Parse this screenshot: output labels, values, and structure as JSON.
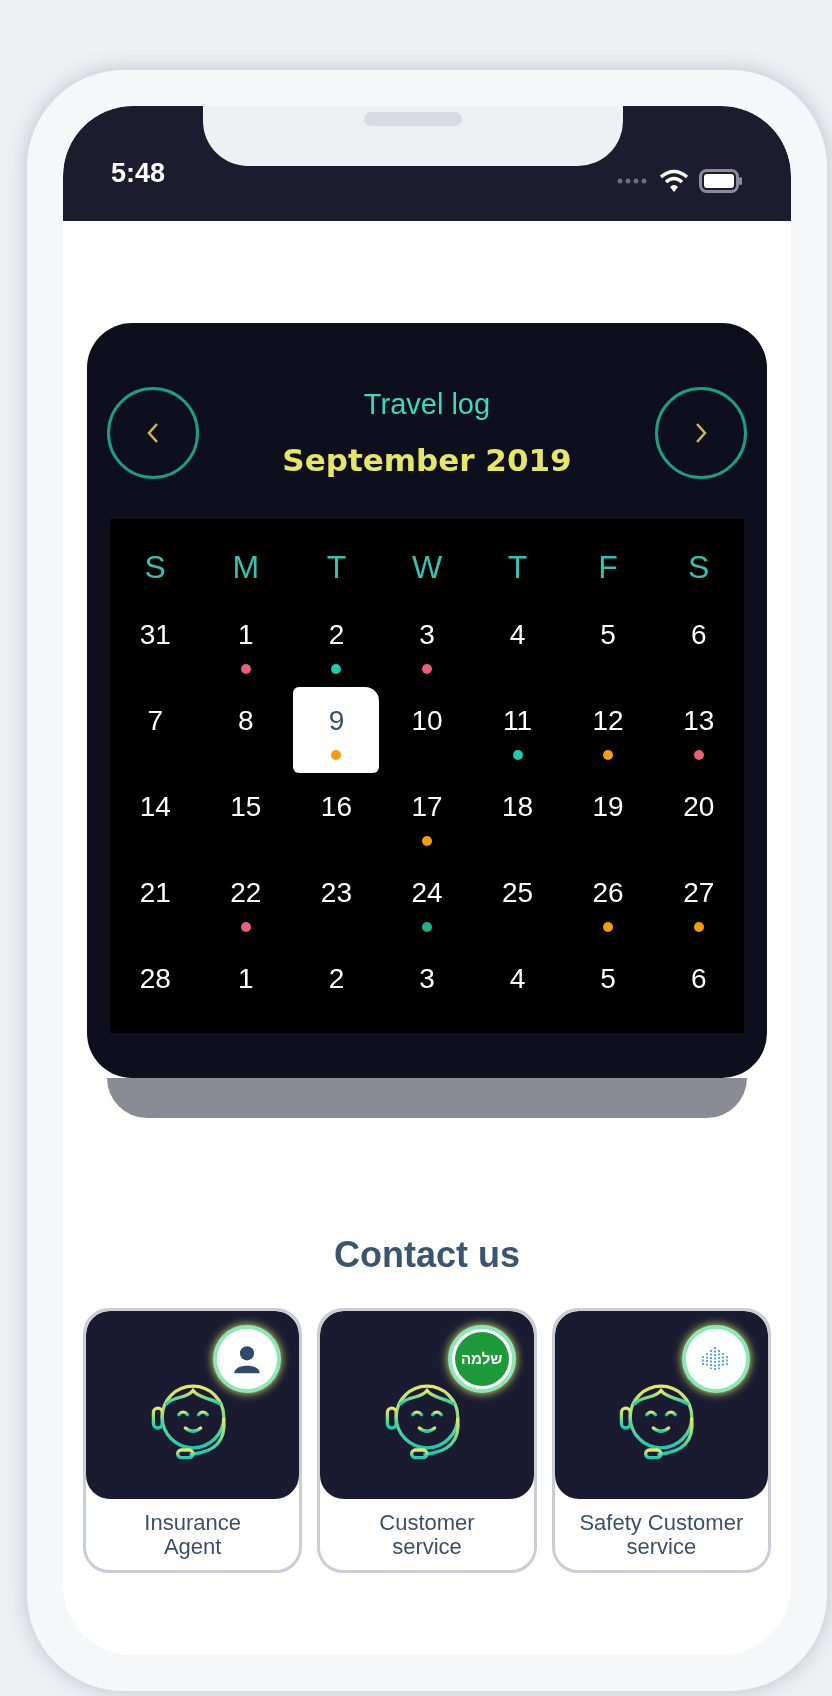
{
  "status_bar": {
    "time": "5:48"
  },
  "calendar": {
    "title": "Travel log",
    "month": "September 2019",
    "weekdays": [
      "S",
      "M",
      "T",
      "W",
      "T",
      "F",
      "S"
    ],
    "weeks": [
      {
        "days": [
          {
            "label": "31",
            "selected": false
          },
          {
            "label": "1",
            "selected": false,
            "color": "#e8607a"
          },
          {
            "label": "2",
            "selected": false,
            "color": "#22c9b0"
          },
          {
            "label": "3",
            "selected": false,
            "color": "#e8607a"
          },
          {
            "label": "4",
            "selected": false
          },
          {
            "label": "5",
            "selected": false
          },
          {
            "label": "6",
            "selected": false
          }
        ]
      },
      {
        "days": [
          {
            "label": "7",
            "selected": false
          },
          {
            "label": "8",
            "selected": false
          },
          {
            "label": "9",
            "selected": true,
            "color": "#f39c12"
          },
          {
            "label": "10",
            "selected": false
          },
          {
            "label": "11",
            "selected": false,
            "color": "#22c9b0"
          },
          {
            "label": "12",
            "selected": false,
            "color": "#f39c12"
          },
          {
            "label": "13",
            "selected": false,
            "color": "#e8607a"
          }
        ]
      },
      {
        "days": [
          {
            "label": "14",
            "selected": false
          },
          {
            "label": "15",
            "selected": false
          },
          {
            "label": "16",
            "selected": false
          },
          {
            "label": "17",
            "selected": false,
            "color": "#f39c12"
          },
          {
            "label": "18",
            "selected": false
          },
          {
            "label": "19",
            "selected": false
          },
          {
            "label": "20",
            "selected": false
          }
        ]
      },
      {
        "days": [
          {
            "label": "21",
            "selected": false
          },
          {
            "label": "22",
            "selected": false,
            "color": "#e8607a"
          },
          {
            "label": "23",
            "selected": false
          },
          {
            "label": "24",
            "selected": false,
            "color": "#22b08a"
          },
          {
            "label": "25",
            "selected": false
          },
          {
            "label": "26",
            "selected": false,
            "color": "#f39c12"
          },
          {
            "label": "27",
            "selected": false,
            "color": "#f39c12"
          }
        ]
      },
      {
        "days": [
          {
            "label": "28",
            "selected": false
          },
          {
            "label": "1",
            "selected": false
          },
          {
            "label": "2",
            "selected": false
          },
          {
            "label": "3",
            "selected": false
          },
          {
            "label": "4",
            "selected": false
          },
          {
            "label": "5",
            "selected": false
          },
          {
            "label": "6",
            "selected": false
          }
        ]
      }
    ]
  },
  "contact": {
    "title": "Contact us",
    "cards": [
      {
        "label": "Insurance\nAgent",
        "badge": {
          "kind": "person"
        }
      },
      {
        "label": "Customer\nservice",
        "badge": {
          "kind": "text",
          "text": "שלמה"
        }
      },
      {
        "label": "Safety Customer\nservice",
        "badge": {
          "kind": "fingerprint"
        }
      }
    ]
  }
}
